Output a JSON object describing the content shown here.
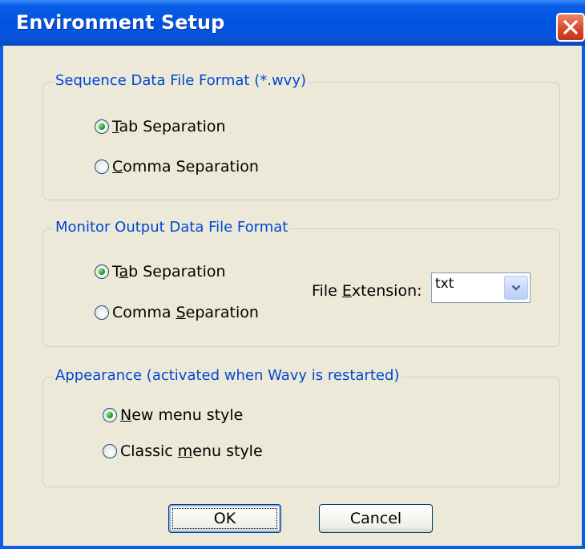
{
  "window": {
    "title": "Environment Setup"
  },
  "sequence_group": {
    "legend": "Sequence Data File Format (*.wvy)",
    "options": [
      {
        "pre": "",
        "mnemonic": "T",
        "post": "ab Separation",
        "checked": true
      },
      {
        "pre": "",
        "mnemonic": "C",
        "post": "omma Separation",
        "checked": false
      }
    ]
  },
  "monitor_group": {
    "legend": "Monitor Output Data File Format",
    "options": [
      {
        "pre": "T",
        "mnemonic": "a",
        "post": "b Separation",
        "checked": true
      },
      {
        "pre": "Comma ",
        "mnemonic": "S",
        "post": "eparation",
        "checked": false
      }
    ],
    "extension_label_pre": "File ",
    "extension_label_mnemonic": "E",
    "extension_label_post": "xtension:",
    "extension_value": "txt"
  },
  "appearance_group": {
    "legend": "Appearance (activated when Wavy is restarted)",
    "options": [
      {
        "pre": "",
        "mnemonic": "N",
        "post": "ew menu style",
        "checked": true
      },
      {
        "pre": "Classic ",
        "mnemonic": "m",
        "post": "enu style",
        "checked": false
      }
    ]
  },
  "buttons": {
    "ok": "OK",
    "cancel": "Cancel"
  }
}
